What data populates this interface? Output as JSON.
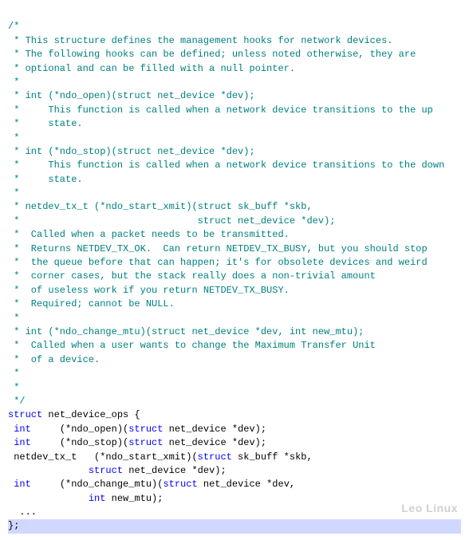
{
  "comment": {
    "open": "/*",
    "l1": " * This structure defines the management hooks for network devices.",
    "l2": " * The following hooks can be defined; unless noted otherwise, they are",
    "l3": " * optional and can be filled with a null pointer.",
    "l4": " *",
    "l5": " * int (*ndo_open)(struct net_device *dev);",
    "l6": " *     This function is called when a network device transitions to the up",
    "l7": " *     state.",
    "l8": " *",
    "l9": " * int (*ndo_stop)(struct net_device *dev);",
    "l10": " *     This function is called when a network device transitions to the down",
    "l11": " *     state.",
    "l12": " *",
    "l13": " * netdev_tx_t (*ndo_start_xmit)(struct sk_buff *skb,",
    "l14": " *                               struct net_device *dev);",
    "l15": " *  Called when a packet needs to be transmitted.",
    "l16": " *  Returns NETDEV_TX_OK.  Can return NETDEV_TX_BUSY, but you should stop",
    "l17": " *  the queue before that can happen; it's for obsolete devices and weird",
    "l18": " *  corner cases, but the stack really does a non-trivial amount",
    "l19": " *  of useless work if you return NETDEV_TX_BUSY.",
    "l20": " *  Required; cannot be NULL.",
    "l21": " *",
    "l22": " * int (*ndo_change_mtu)(struct net_device *dev, int new_mtu);",
    "l23": " *  Called when a user wants to change the Maximum Transfer Unit",
    "l24": " *  of a device.",
    "l25": " *",
    "l26": " *",
    "close": " */"
  },
  "kw": {
    "struct": "struct",
    "int": "int"
  },
  "code": {
    "net_device_ops": " net_device_ops {",
    "open_a": "     (*ndo_open)(",
    "open_b": " net_device *dev);",
    "stop_a": "     (*ndo_stop)(",
    "stop_b": " net_device *dev);",
    "xmit_a": " netdev_tx_t   (*ndo_start_xmit)(",
    "xmit_b": " sk_buff *skb,",
    "xmit_c": "              ",
    "xmit_d": " net_device *dev);",
    "mtu_a": "     (*ndo_change_mtu)(",
    "mtu_b": " net_device *dev,",
    "mtu_c": "              ",
    "mtu_d": " new_mtu);",
    "dots": "  ...",
    "end": "};"
  },
  "watermark": "Leo Linux"
}
